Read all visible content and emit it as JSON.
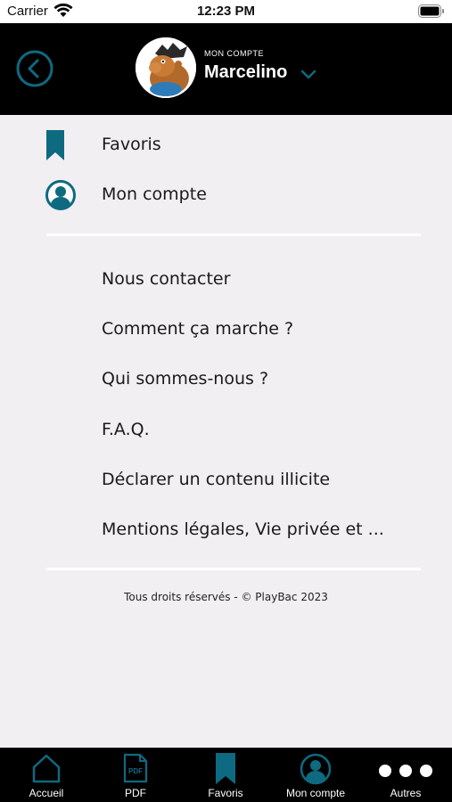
{
  "status_bar": {
    "carrier": "Carrier",
    "time": "12:23 PM"
  },
  "header": {
    "account_label": "MON COMPTE",
    "account_name": "Marcelino"
  },
  "menu": {
    "primary": [
      {
        "label": "Favoris",
        "icon": "bookmark-icon"
      },
      {
        "label": "Mon compte",
        "icon": "user-circle-icon"
      }
    ],
    "secondary": [
      {
        "label": "Nous contacter"
      },
      {
        "label": "Comment ça marche ?"
      },
      {
        "label": "Qui sommes-nous ?"
      },
      {
        "label": "F.A.Q."
      },
      {
        "label": "Déclarer un contenu illicite"
      },
      {
        "label": "Mentions légales, Vie privée et ..."
      }
    ]
  },
  "footer": {
    "copyright": "Tous droits réservés - © PlayBac 2023"
  },
  "tabbar": {
    "tabs": [
      {
        "label": "Accueil",
        "icon": "home-icon"
      },
      {
        "label": "PDF",
        "icon": "pdf-icon"
      },
      {
        "label": "Favoris",
        "icon": "bookmark-icon"
      },
      {
        "label": "Mon compte",
        "icon": "user-circle-icon"
      },
      {
        "label": "Autres",
        "icon": "more-dots-icon"
      }
    ]
  },
  "colors": {
    "accent": "#0e6a80",
    "header_bg": "#000000",
    "page_bg": "#f1eff2"
  }
}
